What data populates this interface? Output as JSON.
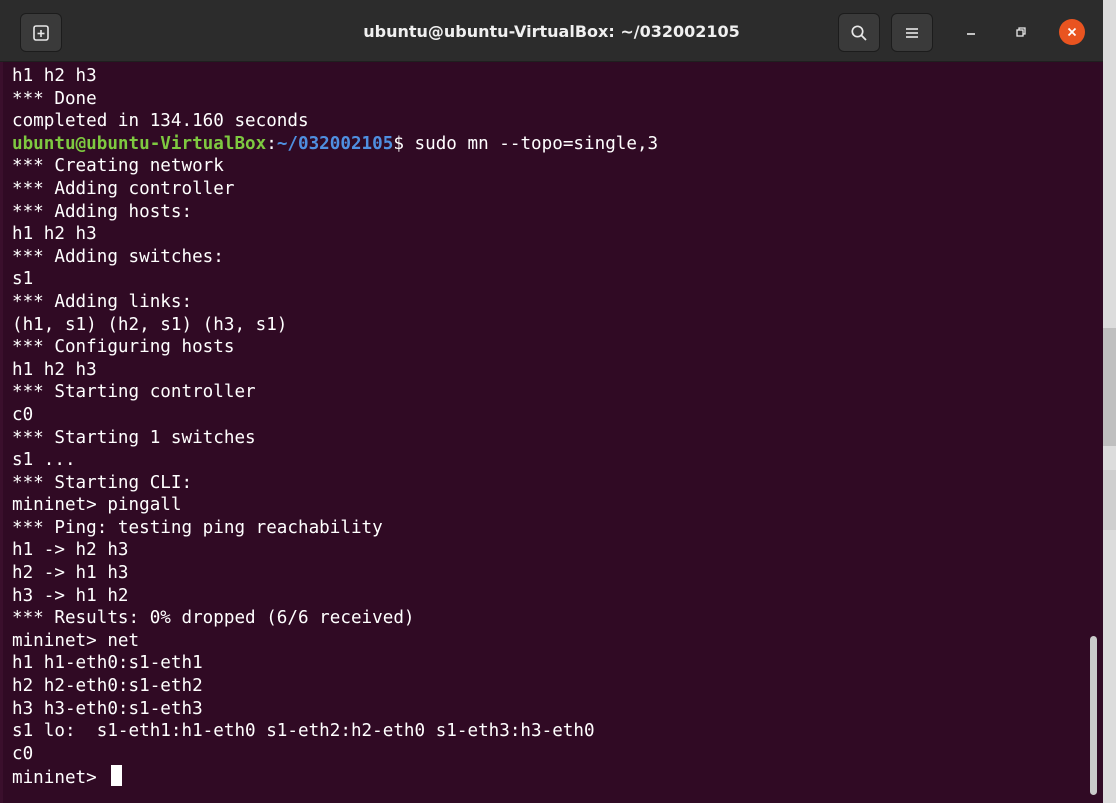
{
  "window": {
    "title": "ubuntu@ubuntu-VirtualBox: ~/032002105",
    "buttons": {
      "new_tab_icon": "new-tab-icon",
      "search_icon": "search-icon",
      "menu_icon": "hamburger-menu-icon",
      "minimize_icon": "minimize-icon",
      "restore_icon": "restore-icon",
      "close_icon": "close-icon"
    }
  },
  "colors": {
    "terminal_bg": "#300a24",
    "prompt_user": "#7ec940",
    "prompt_path": "#4f8fe0",
    "close_button": "#e95420"
  },
  "terminal": {
    "lines": [
      "h1 h2 h3",
      "*** Done",
      "completed in 134.160 seconds",
      "",
      "*** Creating network",
      "*** Adding controller",
      "*** Adding hosts:",
      "h1 h2 h3",
      "*** Adding switches:",
      "s1",
      "*** Adding links:",
      "(h1, s1) (h2, s1) (h3, s1)",
      "*** Configuring hosts",
      "h1 h2 h3",
      "*** Starting controller",
      "c0",
      "*** Starting 1 switches",
      "s1 ...",
      "*** Starting CLI:",
      "mininet> pingall",
      "*** Ping: testing ping reachability",
      "h1 -> h2 h3",
      "h2 -> h1 h3",
      "h3 -> h1 h2",
      "*** Results: 0% dropped (6/6 received)",
      "mininet> net",
      "h1 h1-eth0:s1-eth1",
      "h2 h2-eth0:s1-eth2",
      "h3 h3-eth0:s1-eth3",
      "s1 lo:  s1-eth1:h1-eth0 s1-eth2:h2-eth0 s1-eth3:h3-eth0",
      "c0",
      "mininet> "
    ],
    "prompt": {
      "user": "ubuntu@ubuntu-VirtualBox",
      "sep": ":",
      "path": "~/032002105",
      "symbol": "$",
      "command": " sudo mn --topo=single,3"
    }
  }
}
